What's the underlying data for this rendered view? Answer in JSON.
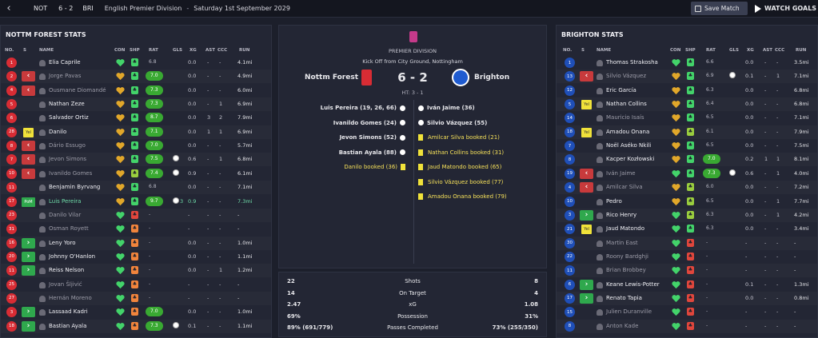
{
  "topbar": {
    "back": "‹",
    "home_abbr": "NOT",
    "score": "6 - 2",
    "away_abbr": "BRI",
    "competition": "English Premier Division",
    "dash": "-",
    "date": "Saturday 1st September 2029",
    "save_label": "Save Match",
    "watch_label": "WATCH GOALS"
  },
  "columns": {
    "no": "NO.",
    "s": "S",
    "name": "NAME",
    "con": "CON",
    "shp": "SHP",
    "rat": "RAT",
    "gls": "GLS",
    "xg": "XG",
    "ast": "AST",
    "ccc": "CCC",
    "run": "RUN"
  },
  "home": {
    "title": "NOTTM FOREST STATS",
    "players": [
      {
        "no": "1",
        "sub": "",
        "name": "Elia Caprile",
        "con": "g",
        "shp": "g",
        "rat": "6.8",
        "pill": false,
        "gls": "",
        "xg": "0.0",
        "ast": "-",
        "ccc": "-",
        "run": "4.1mi",
        "dim": false
      },
      {
        "no": "2",
        "sub": "out",
        "name": "Jorge Pavas",
        "con": "y",
        "shp": "g",
        "rat": "7.0",
        "pill": true,
        "gls": "",
        "xg": "0.0",
        "ast": "-",
        "ccc": "-",
        "run": "4.9mi",
        "dim": true
      },
      {
        "no": "4",
        "sub": "out",
        "name": "Ousmane Diomandé",
        "con": "y",
        "shp": "g",
        "rat": "7.3",
        "pill": true,
        "gls": "",
        "xg": "0.0",
        "ast": "-",
        "ccc": "-",
        "run": "6.0mi",
        "dim": true
      },
      {
        "no": "5",
        "sub": "",
        "name": "Nathan Zeze",
        "con": "y",
        "shp": "g",
        "rat": "7.3",
        "pill": true,
        "gls": "",
        "xg": "0.0",
        "ast": "-",
        "ccc": "1",
        "run": "6.9mi",
        "dim": false
      },
      {
        "no": "6",
        "sub": "",
        "name": "Salvador Ortiz",
        "con": "y",
        "shp": "g",
        "rat": "8.7",
        "pill": true,
        "gls": "",
        "xg": "0.0",
        "ast": "3",
        "ccc": "2",
        "run": "7.9mi",
        "dim": false
      },
      {
        "no": "28",
        "sub": "yel",
        "name": "Danilo",
        "con": "y",
        "shp": "g",
        "rat": "7.1",
        "pill": true,
        "gls": "",
        "xg": "0.0",
        "ast": "1",
        "ccc": "1",
        "run": "6.9mi",
        "dim": false
      },
      {
        "no": "8",
        "sub": "out",
        "name": "Dário Essugo",
        "con": "y",
        "shp": "g",
        "rat": "7.0",
        "pill": true,
        "gls": "",
        "xg": "0.0",
        "ast": "-",
        "ccc": "-",
        "run": "5.7mi",
        "dim": true
      },
      {
        "no": "7",
        "sub": "out",
        "name": "Jevon Simons",
        "con": "y",
        "shp": "g",
        "rat": "7.5",
        "pill": true,
        "gls": "ball",
        "xg": "0.6",
        "ast": "-",
        "ccc": "1",
        "run": "6.8mi",
        "dim": true
      },
      {
        "no": "10",
        "sub": "out",
        "name": "Ivanildo Gomes",
        "con": "y",
        "shp": "l",
        "rat": "7.4",
        "pill": true,
        "gls": "ball",
        "xg": "0.9",
        "ast": "-",
        "ccc": "-",
        "run": "6.1mi",
        "dim": true
      },
      {
        "no": "11",
        "sub": "",
        "name": "Benjamin Byrvang",
        "con": "y",
        "shp": "g",
        "rat": "6.8",
        "pill": false,
        "gls": "",
        "xg": "0.0",
        "ast": "-",
        "ccc": "-",
        "run": "7.1mi",
        "dim": false
      },
      {
        "no": "17",
        "sub": "potm",
        "name": "Luis Pereira",
        "con": "y",
        "shp": "g",
        "rat": "9.7",
        "pill": true,
        "gls": "ball3",
        "xg": "0.9",
        "ast": "-",
        "ccc": "-",
        "run": "7.3mi",
        "dim": false,
        "hl": true
      },
      {
        "no": "23",
        "sub": "",
        "name": "Danilo Vilar",
        "con": "g",
        "shp": "r",
        "rat": "-",
        "pill": false,
        "gls": "",
        "xg": "-",
        "ast": "-",
        "ccc": "-",
        "run": "-",
        "dim": true
      },
      {
        "no": "31",
        "sub": "",
        "name": "Osman Royett",
        "con": "g",
        "shp": "o",
        "rat": "-",
        "pill": false,
        "gls": "",
        "xg": "-",
        "ast": "-",
        "ccc": "-",
        "run": "-",
        "dim": true
      },
      {
        "no": "16",
        "sub": "in",
        "name": "Leny Yoro",
        "con": "g",
        "shp": "o",
        "rat": "-",
        "pill": false,
        "gls": "",
        "xg": "0.0",
        "ast": "-",
        "ccc": "-",
        "run": "1.0mi",
        "dim": false
      },
      {
        "no": "20",
        "sub": "in",
        "name": "Johnny O'Hanlon",
        "con": "g",
        "shp": "o",
        "rat": "-",
        "pill": false,
        "gls": "",
        "xg": "0.0",
        "ast": "-",
        "ccc": "-",
        "run": "1.1mi",
        "dim": false
      },
      {
        "no": "11",
        "sub": "in",
        "name": "Reiss Nelson",
        "con": "g",
        "shp": "o",
        "rat": "-",
        "pill": false,
        "gls": "",
        "xg": "0.0",
        "ast": "-",
        "ccc": "1",
        "run": "1.2mi",
        "dim": false
      },
      {
        "no": "25",
        "sub": "",
        "name": "Jovan Šljivić",
        "con": "g",
        "shp": "o",
        "rat": "-",
        "pill": false,
        "gls": "",
        "xg": "-",
        "ast": "-",
        "ccc": "-",
        "run": "-",
        "dim": true
      },
      {
        "no": "27",
        "sub": "",
        "name": "Hernán Moreno",
        "con": "g",
        "shp": "o",
        "rat": "-",
        "pill": false,
        "gls": "",
        "xg": "-",
        "ast": "-",
        "ccc": "-",
        "run": "-",
        "dim": true
      },
      {
        "no": "3",
        "sub": "in",
        "name": "Lassaad Kadri",
        "con": "g",
        "shp": "o",
        "rat": "7.0",
        "pill": true,
        "gls": "",
        "xg": "0.0",
        "ast": "-",
        "ccc": "-",
        "run": "1.0mi",
        "dim": false
      },
      {
        "no": "18",
        "sub": "in",
        "name": "Bastian Ayala",
        "con": "g",
        "shp": "o",
        "rat": "7.3",
        "pill": true,
        "gls": "ball",
        "xg": "0.1",
        "ast": "-",
        "ccc": "-",
        "run": "1.1mi",
        "dim": false
      }
    ]
  },
  "away": {
    "title": "BRIGHTON STATS",
    "players": [
      {
        "no": "1",
        "sub": "",
        "name": "Thomas Strakosha",
        "con": "g",
        "shp": "g",
        "rat": "6.6",
        "pill": false,
        "gls": "",
        "xg": "0.0",
        "ast": "-",
        "ccc": "-",
        "run": "3.5mi",
        "dim": false
      },
      {
        "no": "13",
        "sub": "out",
        "name": "Silvio Vázquez",
        "con": "y",
        "shp": "g",
        "rat": "6.9",
        "pill": false,
        "gls": "ball",
        "xg": "0.1",
        "ast": "-",
        "ccc": "1",
        "run": "7.1mi",
        "dim": true
      },
      {
        "no": "12",
        "sub": "",
        "name": "Eric García",
        "con": "y",
        "shp": "g",
        "rat": "6.3",
        "pill": false,
        "gls": "",
        "xg": "0.0",
        "ast": "-",
        "ccc": "-",
        "run": "6.8mi",
        "dim": false
      },
      {
        "no": "5",
        "sub": "yel",
        "name": "Nathan Collins",
        "con": "y",
        "shp": "g",
        "rat": "6.4",
        "pill": false,
        "gls": "",
        "xg": "0.0",
        "ast": "-",
        "ccc": "-",
        "run": "6.8mi",
        "dim": false
      },
      {
        "no": "14",
        "sub": "",
        "name": "Mauricio Isaís",
        "con": "y",
        "shp": "g",
        "rat": "6.5",
        "pill": false,
        "gls": "",
        "xg": "0.0",
        "ast": "-",
        "ccc": "-",
        "run": "7.1mi",
        "dim": true
      },
      {
        "no": "18",
        "sub": "yel",
        "name": "Amadou Onana",
        "con": "y",
        "shp": "l",
        "rat": "6.1",
        "pill": false,
        "gls": "",
        "xg": "0.0",
        "ast": "-",
        "ccc": "-",
        "run": "7.9mi",
        "dim": false
      },
      {
        "no": "7",
        "sub": "",
        "name": "Noël Aséko Nkili",
        "con": "y",
        "shp": "g",
        "rat": "6.5",
        "pill": false,
        "gls": "",
        "xg": "0.0",
        "ast": "-",
        "ccc": "-",
        "run": "7.5mi",
        "dim": false
      },
      {
        "no": "8",
        "sub": "",
        "name": "Kacper Kozłowski",
        "con": "y",
        "shp": "g",
        "rat": "7.0",
        "pill": true,
        "gls": "",
        "xg": "0.2",
        "ast": "1",
        "ccc": "1",
        "run": "8.1mi",
        "dim": false
      },
      {
        "no": "19",
        "sub": "out",
        "name": "Iván Jaime",
        "con": "g",
        "shp": "g",
        "rat": "7.3",
        "pill": true,
        "gls": "ball",
        "xg": "0.6",
        "ast": "-",
        "ccc": "1",
        "run": "4.0mi",
        "dim": true
      },
      {
        "no": "4",
        "sub": "out",
        "name": "Amilcar Silva",
        "con": "y",
        "shp": "l",
        "rat": "6.0",
        "pill": false,
        "gls": "",
        "xg": "0.0",
        "ast": "-",
        "ccc": "-",
        "run": "7.2mi",
        "dim": true
      },
      {
        "no": "10",
        "sub": "",
        "name": "Pedro",
        "con": "y",
        "shp": "l",
        "rat": "6.5",
        "pill": false,
        "gls": "",
        "xg": "0.0",
        "ast": "-",
        "ccc": "1",
        "run": "7.7mi",
        "dim": false
      },
      {
        "no": "3",
        "sub": "in",
        "name": "Rico Henry",
        "con": "g",
        "shp": "l",
        "rat": "6.3",
        "pill": false,
        "gls": "",
        "xg": "0.0",
        "ast": "-",
        "ccc": "1",
        "run": "4.2mi",
        "dim": false
      },
      {
        "no": "21",
        "sub": "yel",
        "name": "Jaud Matondo",
        "con": "g",
        "shp": "g",
        "rat": "6.3",
        "pill": false,
        "gls": "",
        "xg": "0.0",
        "ast": "-",
        "ccc": "-",
        "run": "3.4mi",
        "dim": false
      },
      {
        "no": "30",
        "sub": "",
        "name": "Martin East",
        "con": "g",
        "shp": "r",
        "rat": "-",
        "pill": false,
        "gls": "",
        "xg": "-",
        "ast": "-",
        "ccc": "-",
        "run": "-",
        "dim": true
      },
      {
        "no": "22",
        "sub": "",
        "name": "Roony Bardghji",
        "con": "g",
        "shp": "r",
        "rat": "-",
        "pill": false,
        "gls": "",
        "xg": "-",
        "ast": "-",
        "ccc": "-",
        "run": "-",
        "dim": true
      },
      {
        "no": "11",
        "sub": "",
        "name": "Brian Brobbey",
        "con": "g",
        "shp": "r",
        "rat": "-",
        "pill": false,
        "gls": "",
        "xg": "-",
        "ast": "-",
        "ccc": "-",
        "run": "-",
        "dim": true
      },
      {
        "no": "6",
        "sub": "in",
        "name": "Keane Lewis-Potter",
        "con": "g",
        "shp": "r",
        "rat": "-",
        "pill": false,
        "gls": "",
        "xg": "0.1",
        "ast": "-",
        "ccc": "-",
        "run": "1.3mi",
        "dim": false
      },
      {
        "no": "17",
        "sub": "in",
        "name": "Renato Tapia",
        "con": "g",
        "shp": "r",
        "rat": "-",
        "pill": false,
        "gls": "",
        "xg": "0.0",
        "ast": "-",
        "ccc": "-",
        "run": "0.8mi",
        "dim": false
      },
      {
        "no": "15",
        "sub": "",
        "name": "Julien Duranville",
        "con": "g",
        "shp": "r",
        "rat": "-",
        "pill": false,
        "gls": "",
        "xg": "-",
        "ast": "-",
        "ccc": "-",
        "run": "-",
        "dim": true
      },
      {
        "no": "8",
        "sub": "",
        "name": "Anton Kade",
        "con": "g",
        "shp": "r",
        "rat": "-",
        "pill": false,
        "gls": "",
        "xg": "-",
        "ast": "-",
        "ccc": "-",
        "run": "-",
        "dim": true
      }
    ]
  },
  "match": {
    "competition": "PREMIER DIVISION",
    "kickoff": "Kick Off from City Ground, Nottingham",
    "home_team": "Nottm Forest",
    "away_team": "Brighton",
    "score": "6 - 2",
    "halftime": "HT: 3 - 1",
    "home_events": [
      {
        "text": "Luis Pereira (19, 26, 66)",
        "type": "goal"
      },
      {
        "text": "Ivanildo Gomes (24)",
        "type": "goal"
      },
      {
        "text": "Jevon Simons (52)",
        "type": "goal"
      },
      {
        "text": "Bastian Ayala (88)",
        "type": "goal"
      },
      {
        "text": "Danilo booked (36)",
        "type": "card"
      }
    ],
    "away_events": [
      {
        "text": "Iván Jaime (36)",
        "type": "goal"
      },
      {
        "text": "Silvio Vázquez (55)",
        "type": "goal"
      },
      {
        "text": "Amilcar Silva booked (21)",
        "type": "card"
      },
      {
        "text": "Nathan Collins booked (31)",
        "type": "card"
      },
      {
        "text": "Jaud Matondo booked (65)",
        "type": "card"
      },
      {
        "text": "Silvio Vázquez booked (77)",
        "type": "card"
      },
      {
        "text": "Amadou Onana booked (79)",
        "type": "card"
      }
    ]
  },
  "team_stats": [
    {
      "home": "22",
      "label": "Shots",
      "away": "8"
    },
    {
      "home": "14",
      "label": "On Target",
      "away": "4"
    },
    {
      "home": "2.47",
      "label": "xG",
      "away": "1.08"
    },
    {
      "home": "69%",
      "label": "Possession",
      "away": "31%"
    },
    {
      "home": "89% (691/779)",
      "label": "Passes Completed",
      "away": "73% (255/350)"
    }
  ],
  "colors": {
    "home_accent": "#d82c34",
    "away_accent": "#1f4fb8",
    "good": "#43d36a",
    "warn": "#e1a72a",
    "bad": "#e0463c"
  }
}
